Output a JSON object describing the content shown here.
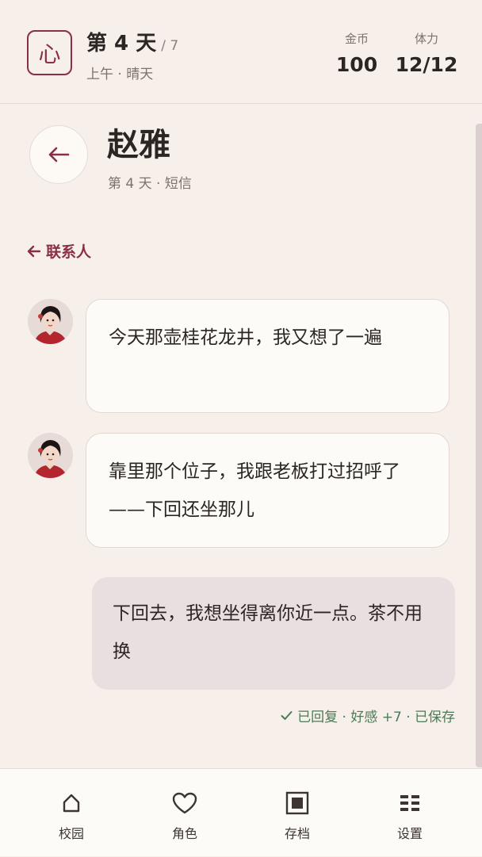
{
  "header": {
    "logo_char": "心",
    "day_title": "第 4 天",
    "day_total": "/ 7",
    "time_weather": "上午 · 晴天",
    "coins_label": "金币",
    "coins_value": "100",
    "stamina_label": "体力",
    "stamina_value": "12/12"
  },
  "chat": {
    "back_icon": "arrow-left-icon",
    "contact_name": "赵雅",
    "subtitle": "第 4 天 · 短信",
    "contacts_link": "联系人",
    "messages": [
      {
        "from": "contact",
        "text": "今天那壶桂花龙井，我又想了一遍"
      },
      {
        "from": "contact",
        "text": "靠里那个位子，我跟老板打过招呼了——下回还坐那儿"
      },
      {
        "from": "me",
        "text": "下回去，我想坐得离你近一点。茶不用换"
      }
    ],
    "status": "已回复 · 好感 +7 · 已保存"
  },
  "nav": {
    "items": [
      {
        "label": "校园",
        "icon": "house-icon"
      },
      {
        "label": "角色",
        "icon": "heart-icon"
      },
      {
        "label": "存档",
        "icon": "save-square-icon"
      },
      {
        "label": "设置",
        "icon": "settings-grid-icon"
      }
    ]
  },
  "colors": {
    "accent": "#8a2f45",
    "background": "#f6efea",
    "bubble_in": "#fdfbf7",
    "bubble_out": "#eadfe0",
    "status_green": "#4d7a57"
  }
}
